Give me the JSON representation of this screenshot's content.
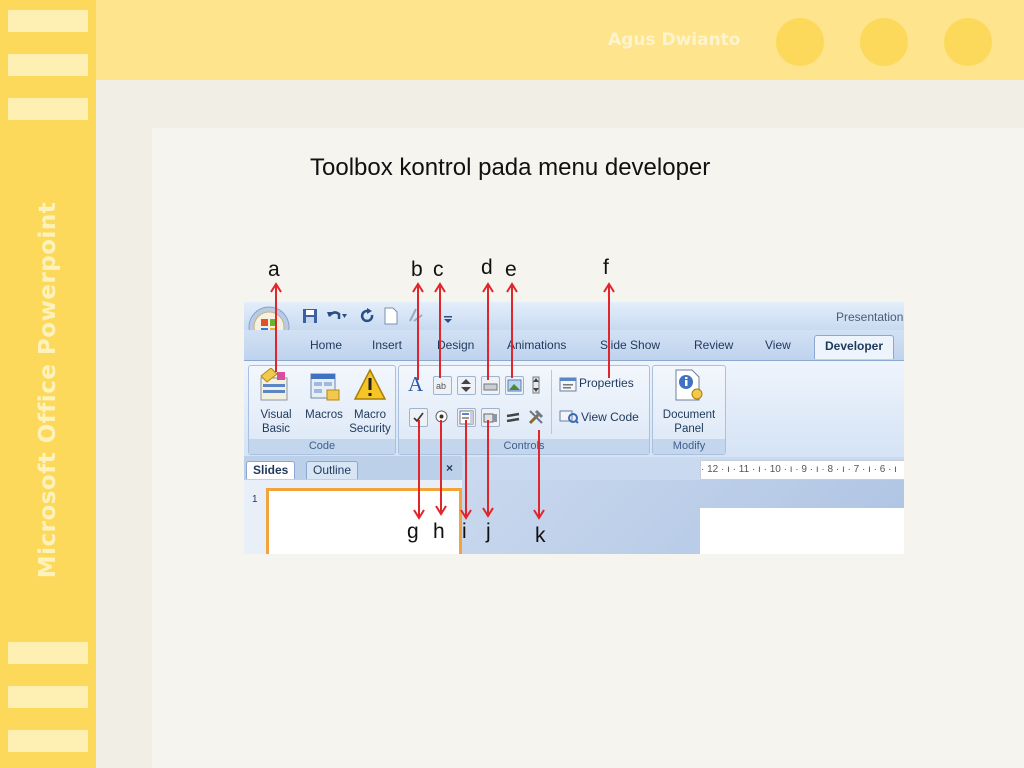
{
  "slide": {
    "sidebar_title": "Microsoft Office Powerpoint",
    "author": "Agus Dwianto",
    "title": "Toolbox kontrol  pada menu developer"
  },
  "ppt": {
    "window_title": "Presentation",
    "tabs": [
      "Home",
      "Insert",
      "Design",
      "Animations",
      "Slide Show",
      "Review",
      "View",
      "Developer"
    ],
    "active_tab": "Developer",
    "groups": {
      "code": {
        "label": "Code",
        "buttons": [
          {
            "line1": "Visual",
            "line2": "Basic"
          },
          {
            "line1": "Macros",
            "line2": ""
          },
          {
            "line1": "Macro",
            "line2": "Security"
          }
        ]
      },
      "controls": {
        "label": "Controls",
        "properties": "Properties",
        "view_code": "View Code"
      },
      "modify": {
        "label": "Modify",
        "button": {
          "line1": "Document",
          "line2": "Panel"
        }
      }
    },
    "panel_tabs": [
      "Slides",
      "Outline"
    ],
    "close_glyph": "×",
    "slide_number": "1",
    "ruler_text": "· 12 · ı · 11 · ı · 10 · ı · 9 · ı · 8 · ı · 7 · ı · 6 · ı"
  },
  "annotations": [
    "a",
    "b",
    "c",
    "d",
    "e",
    "f",
    "g",
    "h",
    "i",
    "j",
    "k"
  ],
  "colors": {
    "sidebar": "#fcd95a",
    "topband": "#fde48d",
    "arrow": "#e0262b",
    "ribbon_text": "#1e395b"
  }
}
